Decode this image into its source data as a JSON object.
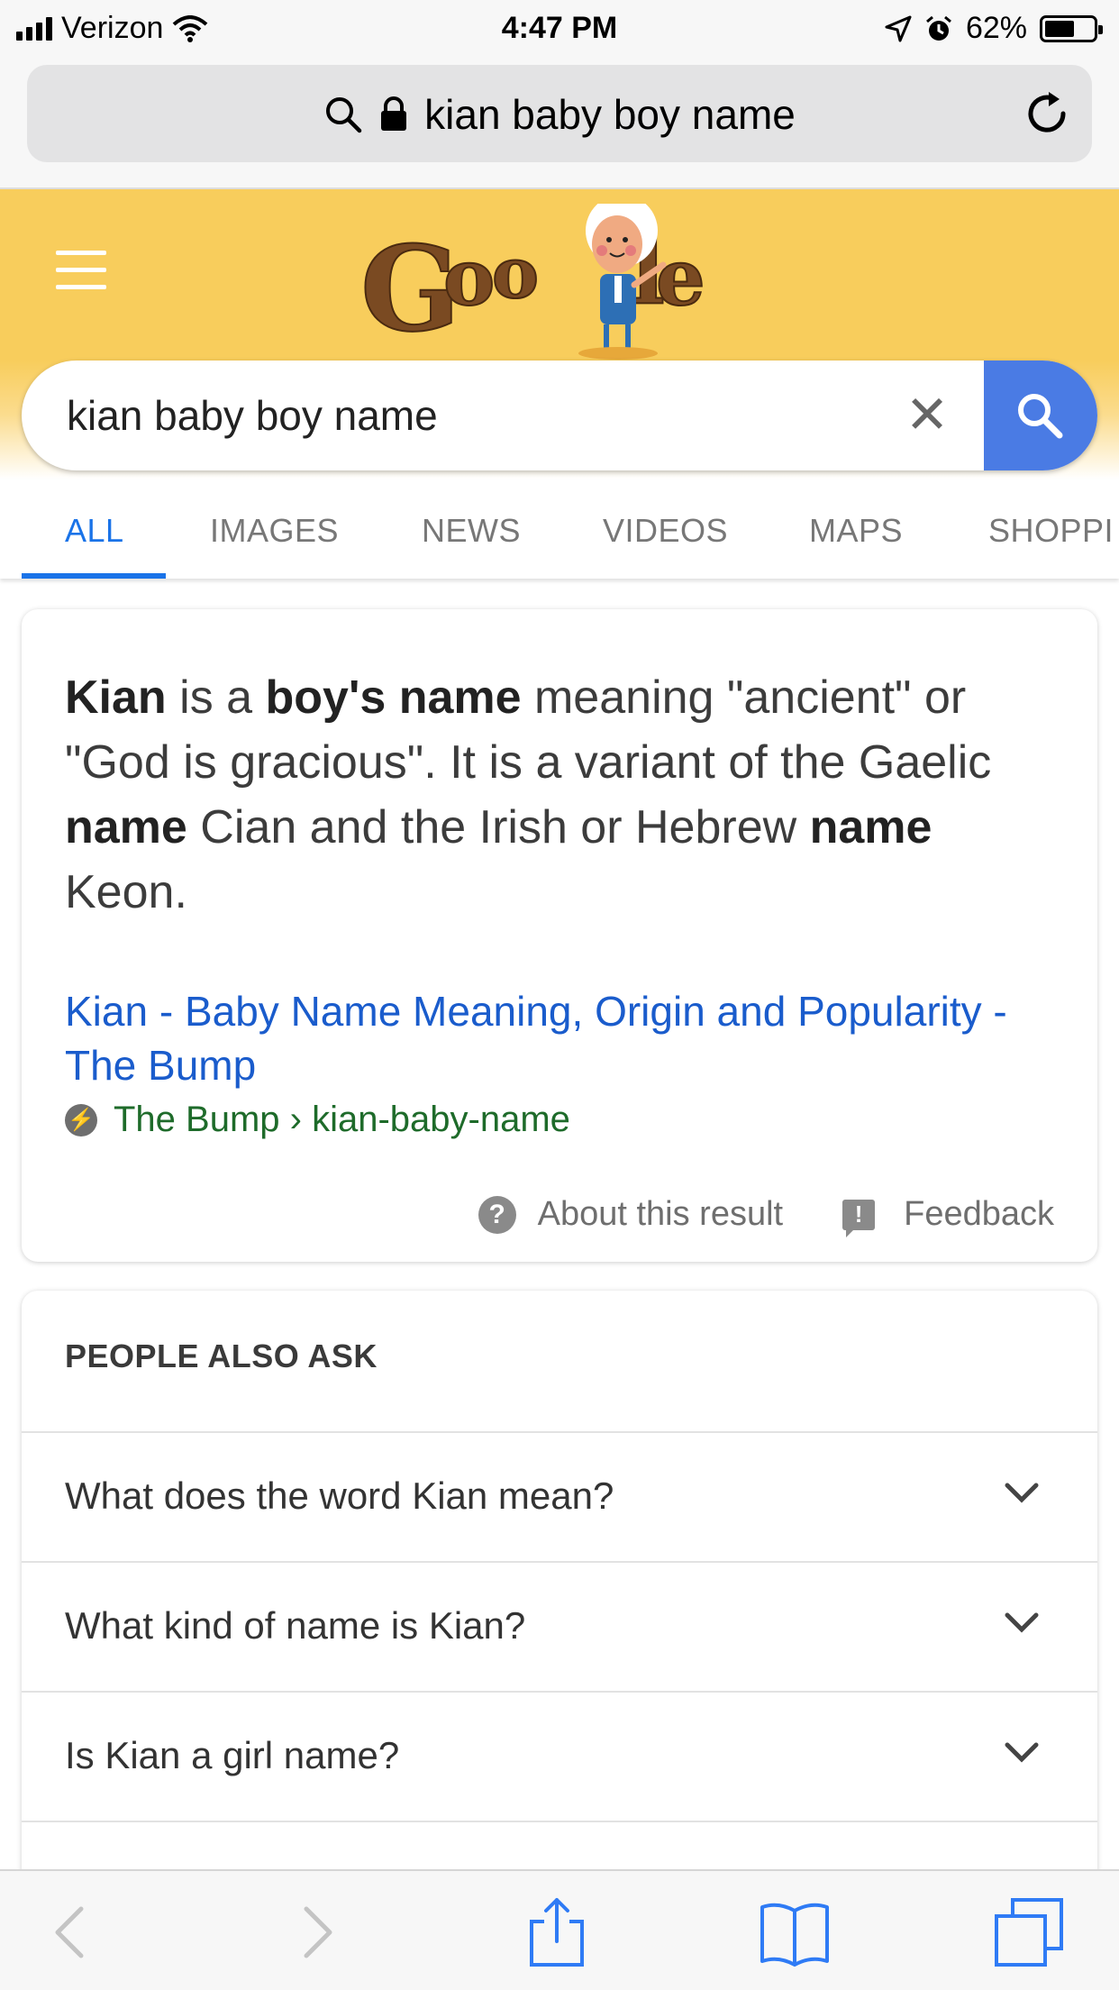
{
  "status": {
    "carrier": "Verizon",
    "time": "4:47 PM",
    "battery": "62%",
    "battery_level": 0.62
  },
  "url_bar": {
    "text": "kian baby boy name"
  },
  "search": {
    "query": "kian baby boy name",
    "clear_label": "✕"
  },
  "tabs": [
    "ALL",
    "IMAGES",
    "NEWS",
    "VIDEOS",
    "MAPS",
    "SHOPPI"
  ],
  "featured": {
    "term": "Kian",
    "t1": " is a ",
    "b1": "boy's name",
    "t2": " meaning \"ancient\" or \"God is gracious\". It is a variant of the Gaelic ",
    "b2": "name",
    "t3": " Cian and the Irish or Hebrew ",
    "b3": "name",
    "t4": " Keon.",
    "link": "Kian - Baby Name Meaning, Origin and Popularity - The Bump",
    "source_site": "The Bump",
    "source_path": " › kian-baby-name",
    "about": "About this result",
    "feedback": "Feedback"
  },
  "people_also_ask": {
    "title": "PEOPLE ALSO ASK",
    "questions": [
      "What does the word Kian mean?",
      "What kind of name is Kian?",
      "Is Kian a girl name?"
    ]
  },
  "colors": {
    "doodle_bg": "#f8cd5c",
    "search_button": "#4a7be4",
    "link": "#1a5ccc",
    "source_green": "#1e6b2a",
    "active_tab": "#1a73e8",
    "toolbar_icon": "#2f7bf5"
  },
  "icons": [
    "search-icon",
    "lock-icon",
    "reload-icon",
    "menu-icon",
    "clear-icon",
    "back-icon",
    "forward-icon",
    "share-icon",
    "bookmarks-icon",
    "tabs-icon"
  ]
}
